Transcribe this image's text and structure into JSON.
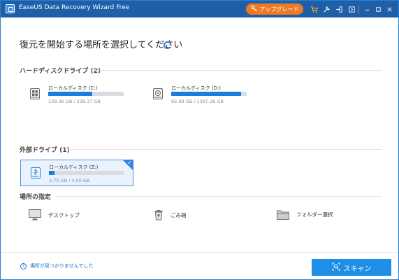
{
  "window": {
    "title": "EaseUS Data Recovery Wizard Free",
    "upgrade_label": "アップグレード"
  },
  "titlebar_icons": [
    "cart-icon",
    "settings-icon",
    "login-icon",
    "expand-icon",
    "minimize-icon",
    "maximize-icon",
    "close-icon"
  ],
  "heading": "復元を開始する場所を選択してください",
  "sections": {
    "hard_disk": "ハードディスクドライブ (2)",
    "external": "外部ドライブ (1)",
    "locations": "場所の指定"
  },
  "drives": [
    {
      "label": "ローカルディスク (C:)",
      "size": "139.36 GB / 238.37 GB",
      "used_fraction": 0.585,
      "icon": "windows-drive-icon"
    },
    {
      "label": "ローカルディスク (D:)",
      "size": "92.69 GB / 1397.26 GB",
      "used_fraction": 0.93,
      "icon": "hard-drive-icon"
    }
  ],
  "external_drives": [
    {
      "label": "ローカルディスク (Z:)",
      "size": "3.70 GB / 4.00 GB",
      "used_fraction": 0.07,
      "selected": true,
      "icon": "usb-drive-icon"
    }
  ],
  "locations": [
    {
      "label": "デスクトップ",
      "icon": "desktop-icon"
    },
    {
      "label": "ごみ箱",
      "icon": "recycle-bin-icon"
    },
    {
      "label": "フォルダー選択",
      "icon": "folder-icon"
    }
  ],
  "footer": {
    "help_text": "場所が見つかりませんでした",
    "scan_label": "スキャン"
  },
  "colors": {
    "titlebar": "#1f5fa8",
    "accent": "#1a7fdc",
    "upgrade": "#ee7a24",
    "scan_button": "#1e8ee9"
  }
}
